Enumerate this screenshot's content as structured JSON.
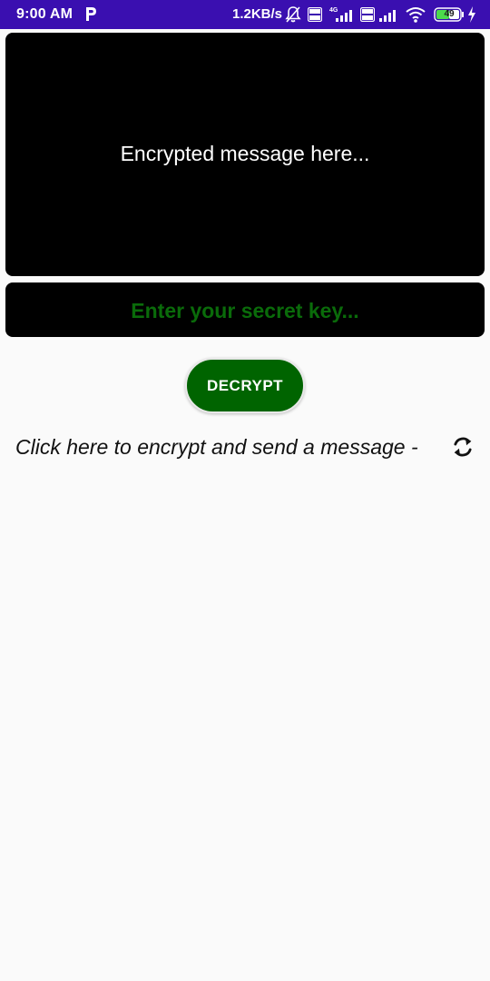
{
  "status_bar": {
    "time": "9:00 AM",
    "speed": "1.2KB/s",
    "battery": "49",
    "icons": [
      "parking-icon",
      "alarm-off-icon",
      "volte-icon",
      "signal-4g-icon",
      "volte-icon",
      "signal-icon",
      "wifi-icon",
      "battery-icon",
      "charging-icon"
    ],
    "background": "#3a0fb0"
  },
  "message_box": {
    "text": "Encrypted message here...",
    "background": "#000000",
    "text_color": "#ffffff"
  },
  "key_input": {
    "placeholder": "Enter your secret key...",
    "value": "",
    "text_color": "#0a6b0a"
  },
  "decrypt_button": {
    "label": "DECRYPT",
    "background": "#006400"
  },
  "encrypt_link": {
    "text": "Click here to encrypt and send a message -",
    "icon": "refresh-icon"
  }
}
